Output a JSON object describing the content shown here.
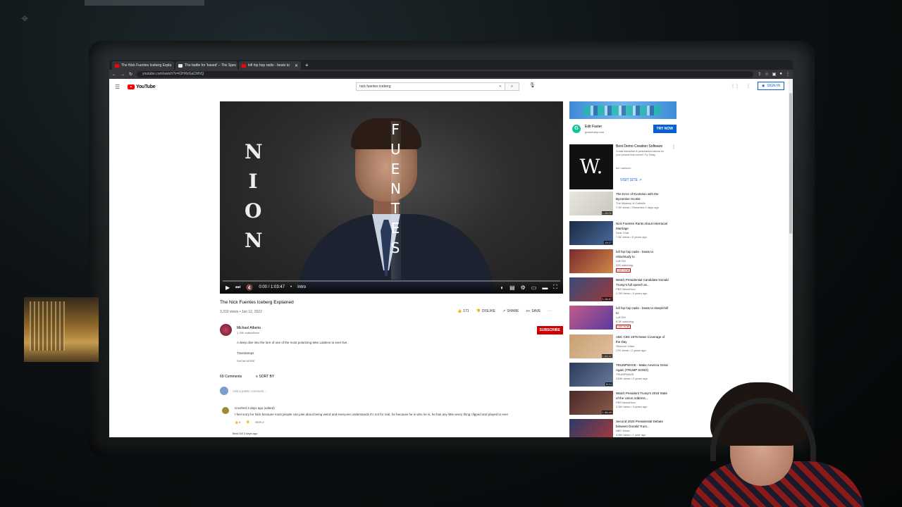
{
  "browser": {
    "tabs": [
      {
        "label": "The Nick Fuentes Iceberg Expla",
        "favicon": "youtube-icon"
      },
      {
        "label": "The battle for 'based' – The Spec",
        "favicon": "page-icon"
      },
      {
        "label": "lofi hip hop radio - beats to",
        "favicon": "youtube-icon"
      }
    ],
    "url": "youtube.com/watch?v=iOHXkGaCMVQ"
  },
  "youtube": {
    "logo": "YouTube",
    "search_value": "nick fuentes iceberg",
    "sign_in": "SIGN IN"
  },
  "player": {
    "left_letters": [
      "N",
      "I",
      "O",
      "N"
    ],
    "right_letters": [
      "F",
      "U",
      "E",
      "N",
      "T",
      "E",
      "S"
    ],
    "time": "0:00 / 1:03:47",
    "chapter": "Intro"
  },
  "video": {
    "title": "The Nick Fuentes Iceberg Explained",
    "meta": "3,333 views • Jan 12, 2022",
    "likes": "171",
    "dislike": "DISLIKE",
    "share": "SHARE",
    "save": "SAVE"
  },
  "channel": {
    "name": "Michael Alberto",
    "subs": "1.76K subscribers",
    "subscribe": "SUBSCRIBE",
    "description": "A deep dive into the lore of one of the most polarizing Wes Liddens to ever live.",
    "timestamps": "Timestamps",
    "show_more": "SHOW MORE"
  },
  "comments": {
    "count": "69 Comments",
    "sort": "SORT BY",
    "placeholder": "Add a public comment...",
    "first": {
      "author": "Crushed  3 days ago (edited)",
      "text": "I feel sorry for Nick because most people can joke about being weird and everyone understands it's not for real, for because he is who he is, he has any little worry thing clipped and played to ever",
      "likes": "6",
      "reply": "REPLY"
    },
    "second_author": "Best Dill  3 days ago"
  },
  "sidebar": {
    "ad": {
      "title": "Edit Faster",
      "domain": "grammarly.com",
      "cta": "TRY NOW"
    },
    "w_ad": {
      "title": "Best Demo Creation Software",
      "desc": "Create interactive & personalized demos for your product that convert. Try Today.",
      "badge": "Ad • walnut.io",
      "visit": "VISIT SITE"
    },
    "recs": [
      {
        "title": "The Error of Evolution with the Byzantine Scotist",
        "channel": "The Mystery of Catholic",
        "views": "7.9K views • Streamed 4 days ago",
        "duration": "1:28:00",
        "live": ""
      },
      {
        "title": "Nick Fuentes Rants About Interracial Marriage",
        "channel": "Dear Chat",
        "views": "7.8K views • 5 years ago",
        "duration": "19:27",
        "live": ""
      },
      {
        "title": "lofi hip hop radio - beats to relax/study to",
        "channel": "Lofi Girl",
        "views": "22K watching",
        "duration": "",
        "live": "LIVE NOW"
      },
      {
        "title": "Watch Presidential Candidate Donald Trump's full speech at...",
        "channel": "PBS NewsHour",
        "views": "2.2M views • 5 years ago",
        "duration": "1:16:47",
        "live": ""
      },
      {
        "title": "lofi hip hop radio - beats to sleep/chill to",
        "channel": "Lofi Girl",
        "views": "8.3K watching",
        "duration": "",
        "live": "LIVE NOW"
      },
      {
        "title": "ABC CBS 1975 News Coverage of the Day",
        "channel": "Obscure Video",
        "views": "17K views • 2 years ago",
        "duration": "1:04:12",
        "live": ""
      },
      {
        "title": "TRUMPWAVE - Make America Great Again (TRUMP SONG)",
        "channel": "TRUMPWAVE",
        "views": "316K views • 2 years ago",
        "duration": "8:14",
        "live": ""
      },
      {
        "title": "Watch President Trump's 2018 State of the Union Address...",
        "channel": "PBS NewsHour",
        "views": "2.5M views • 4 years ago",
        "duration": "1:38:49",
        "live": ""
      },
      {
        "title": "Second 2020 Presidential Debate between Donald Trum...",
        "channel": "NBC News",
        "views": "4.8M views • 1 year ago",
        "duration": "",
        "live": ""
      }
    ]
  }
}
